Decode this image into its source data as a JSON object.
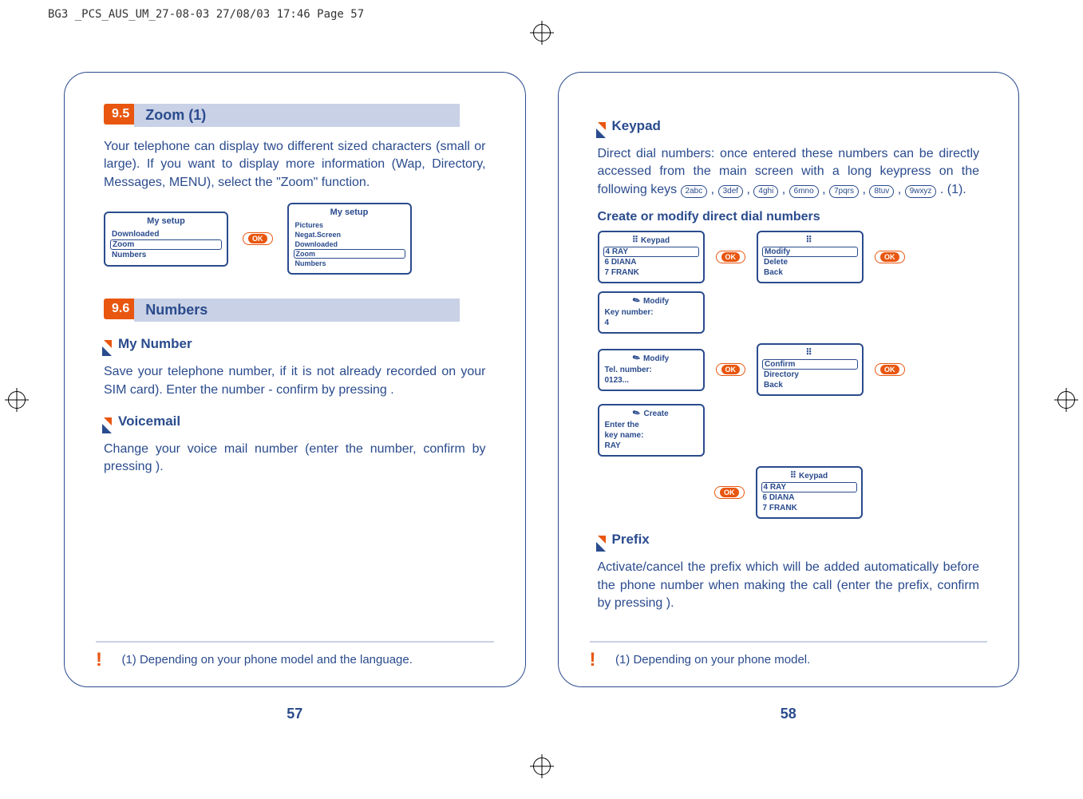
{
  "header": "BG3 _PCS_AUS_UM_27-08-03  27/08/03  17:46  Page 57",
  "left": {
    "sec1": {
      "num": "9.5",
      "title": "Zoom (1)"
    },
    "p1": "Your telephone can display two different sized characters (small or large). If you want to display more information (Wap, Directory, Messages, MENU), select the \"Zoom\" function.",
    "screenA": {
      "title": "My setup",
      "rows": [
        "Downloaded",
        "Zoom",
        "Numbers"
      ],
      "boxed": "Zoom"
    },
    "screenB": {
      "title": "My setup",
      "rows": [
        "Pictures",
        "Negat.Screen",
        "Downloaded",
        "Zoom",
        "Numbers"
      ],
      "boxed": "Zoom"
    },
    "sec2": {
      "num": "9.6",
      "title": "Numbers"
    },
    "sub1": "My Number",
    "p2": "Save your telephone number, if it is not already recorded on your SIM card). Enter the number - confirm by pressing  .",
    "sub2": "Voicemail",
    "p3": "Change your voice mail number (enter the number, confirm by pressing  ).",
    "note": "(1)  Depending on your phone model and the language.",
    "page": "57"
  },
  "right": {
    "sub1": "Keypad",
    "p1a": "Direct dial numbers: once entered these numbers can be directly accessed from the main screen with a long keypress on the following keys ",
    "keys": [
      "2abc",
      "3def",
      "4ghi",
      "6mno",
      "7pqrs",
      "8tuv",
      "9wxyz"
    ],
    "p1b": " . (1).",
    "head2": "Create or modify direct dial numbers",
    "s1": {
      "title": "Keypad",
      "rows": [
        "4  RAY",
        "6  DIANA",
        "7  FRANK"
      ],
      "boxed": "4  RAY"
    },
    "s2": {
      "rows": [
        "Modify",
        "Delete",
        "Back"
      ],
      "boxed": "Modify"
    },
    "s3": {
      "title": "Modify",
      "line1": "Key number:",
      "line2": "4"
    },
    "s4": {
      "title": "Modify",
      "line1": "Tel. number:",
      "line2": "0123..."
    },
    "s5": {
      "rows": [
        "Confirm",
        "Directory",
        "Back"
      ],
      "boxed": "Confirm"
    },
    "s6": {
      "title": "Create",
      "line1": "Enter the",
      "line2": "key name:",
      "line3": "RAY"
    },
    "s7": {
      "title": "Keypad",
      "rows": [
        "4  RAY",
        "6  DIANA",
        "7  FRANK"
      ],
      "boxed": "4  RAY"
    },
    "sub2": "Prefix",
    "p2": "Activate/cancel the prefix which will be added automatically before the phone number when making the call (enter the prefix, confirm by pressing  ).",
    "note": "(1)  Depending on your phone model.",
    "page": "58"
  },
  "ok": "OK"
}
